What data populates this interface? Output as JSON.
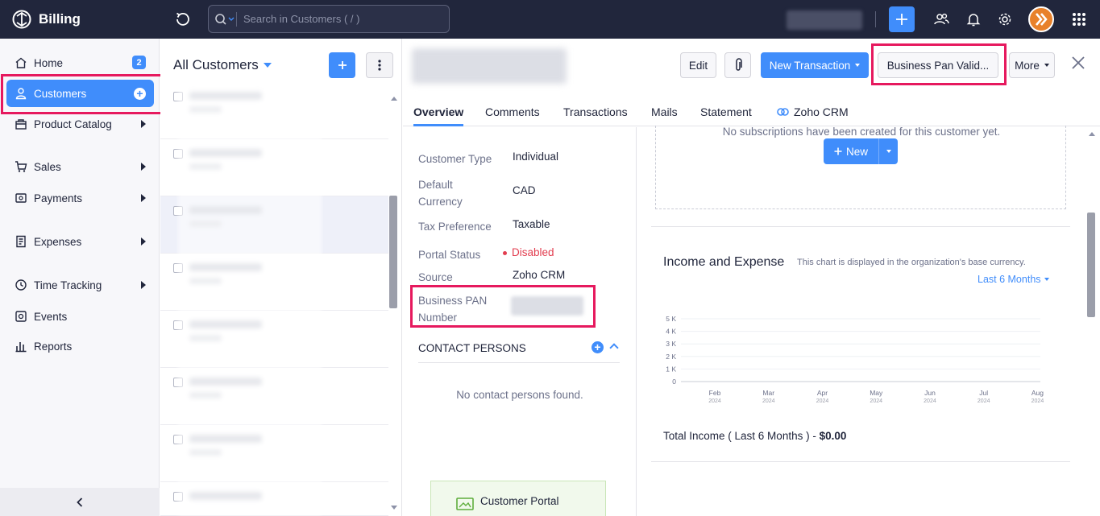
{
  "app": {
    "name": "Billing"
  },
  "search": {
    "placeholder": "Search in Customers ( / )"
  },
  "icons": {
    "logo": "billing-logo-icon",
    "recent": "history-icon",
    "search": "search-icon",
    "quick_add": "plus-icon",
    "referral": "users-icon",
    "notifications": "bell-icon",
    "settings": "gear-icon",
    "apps": "grid-icon"
  },
  "colors": {
    "topbar": "#21263c",
    "accent": "#408dfb",
    "highlight": "#e6195e",
    "disabled": "#e23d4f"
  },
  "sidebar": {
    "items": [
      {
        "label": "Home",
        "icon": "home-icon",
        "badge": "2"
      },
      {
        "label": "Customers",
        "icon": "user-icon",
        "active": true
      },
      {
        "label": "Product Catalog",
        "icon": "box-icon"
      },
      {
        "label": "Sales",
        "icon": "cart-icon"
      },
      {
        "label": "Payments",
        "icon": "payment-icon"
      },
      {
        "label": "Expenses",
        "icon": "receipt-icon"
      },
      {
        "label": "Time Tracking",
        "icon": "clock-icon"
      },
      {
        "label": "Events",
        "icon": "events-icon"
      },
      {
        "label": "Reports",
        "icon": "bar-chart-icon"
      }
    ]
  },
  "list": {
    "title": "All Customers"
  },
  "detail": {
    "buttons": {
      "edit": "Edit",
      "new_transaction": "New Transaction",
      "business_pan": "Business Pan Valid...",
      "more": "More"
    },
    "tabs": [
      "Overview",
      "Comments",
      "Transactions",
      "Mails",
      "Statement",
      "Zoho CRM"
    ],
    "info": {
      "customer_type": {
        "label": "Customer Type",
        "value": "Individual"
      },
      "currency": {
        "label": "Default Currency",
        "value": "CAD"
      },
      "tax": {
        "label": "Tax Preference",
        "value": "Taxable"
      },
      "portal": {
        "label": "Portal Status",
        "value": "Disabled"
      },
      "source": {
        "label": "Source",
        "value": "Zoho CRM"
      },
      "pan": {
        "label": "Business PAN Number"
      }
    },
    "contacts": {
      "header": "CONTACT PERSONS",
      "empty": "No contact persons found."
    },
    "portal_card": {
      "title": "Customer Portal"
    },
    "subscriptions": {
      "empty": "No subscriptions have been created for this customer yet.",
      "new_label": "New"
    },
    "income": {
      "title": "Income and Expense",
      "subtitle": "This chart is displayed in the organization's base currency.",
      "period": "Last 6 Months",
      "total_label": "Total Income ( Last 6 Months ) - ",
      "total_value": "$0.00"
    }
  },
  "chart_data": {
    "type": "bar",
    "categories": [
      "Feb 2024",
      "Mar 2024",
      "Apr 2024",
      "May 2024",
      "Jun 2024",
      "Jul 2024",
      "Aug 2024"
    ],
    "months": [
      "Feb",
      "Mar",
      "Apr",
      "May",
      "Jun",
      "Jul",
      "Aug"
    ],
    "years": [
      "2024",
      "2024",
      "2024",
      "2024",
      "2024",
      "2024",
      "2024"
    ],
    "y_ticks": [
      "5 K",
      "4 K",
      "3 K",
      "2 K",
      "1 K",
      "0"
    ],
    "y_values": [
      5000,
      4000,
      3000,
      2000,
      1000,
      0
    ],
    "ylim": [
      0,
      5000
    ],
    "series": [
      {
        "values": [
          0,
          0,
          0,
          0,
          0,
          0,
          0
        ]
      }
    ],
    "grid": true
  }
}
